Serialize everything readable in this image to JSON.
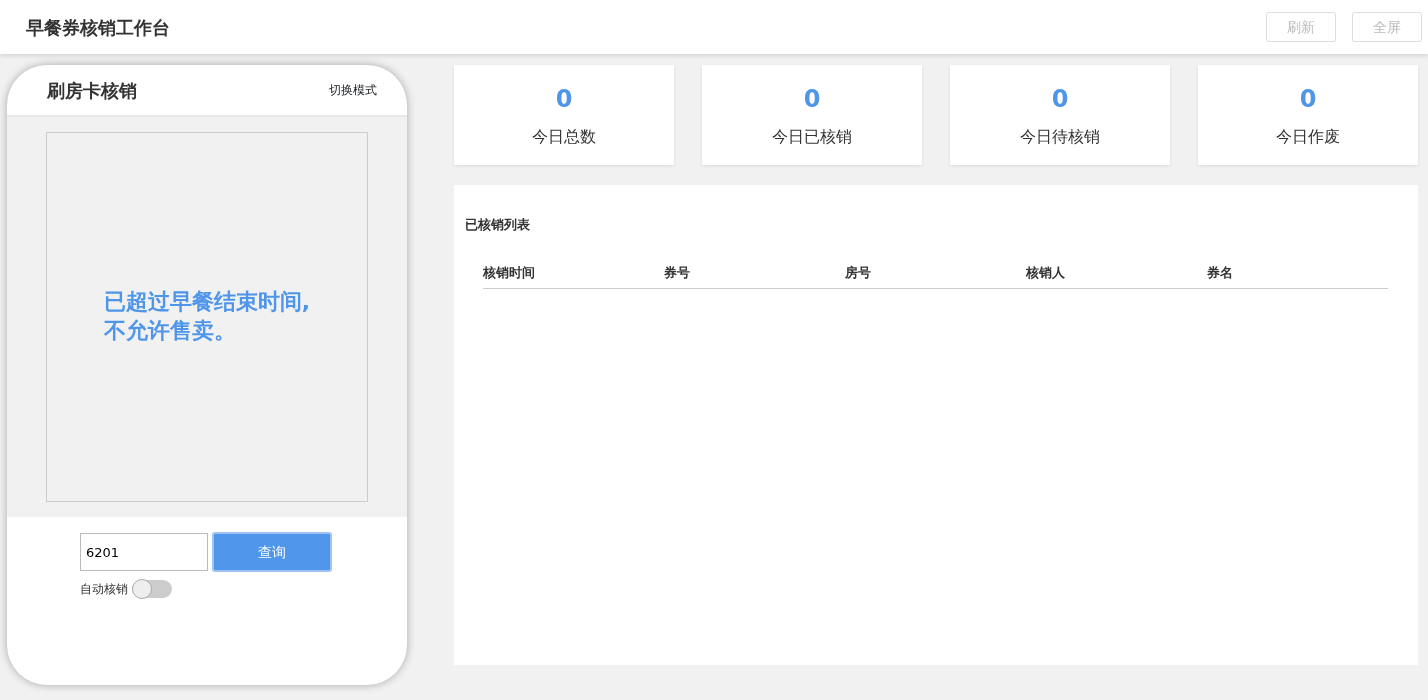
{
  "header": {
    "title": "早餐券核销工作台",
    "buttons": [
      {
        "label": "刷新",
        "disabled": true
      },
      {
        "label": "全屏",
        "disabled": true
      }
    ]
  },
  "scanner": {
    "title": "刷房卡核销",
    "switch_mode": "切换模式",
    "message": "已超过早餐结束时间,\n不允许售卖。",
    "room_input": {
      "value": "6201"
    },
    "query_button": "查询",
    "auto_verify": {
      "label": "自动核销",
      "on": false
    }
  },
  "stats": [
    {
      "value": "0",
      "label": "今日总数"
    },
    {
      "value": "0",
      "label": "今日已核销"
    },
    {
      "value": "0",
      "label": "今日待核销"
    },
    {
      "value": "0",
      "label": "今日作废"
    }
  ],
  "table": {
    "title": "已核销列表",
    "columns": [
      "核销时间",
      "券号",
      "房号",
      "核销人",
      "券名"
    ]
  }
}
